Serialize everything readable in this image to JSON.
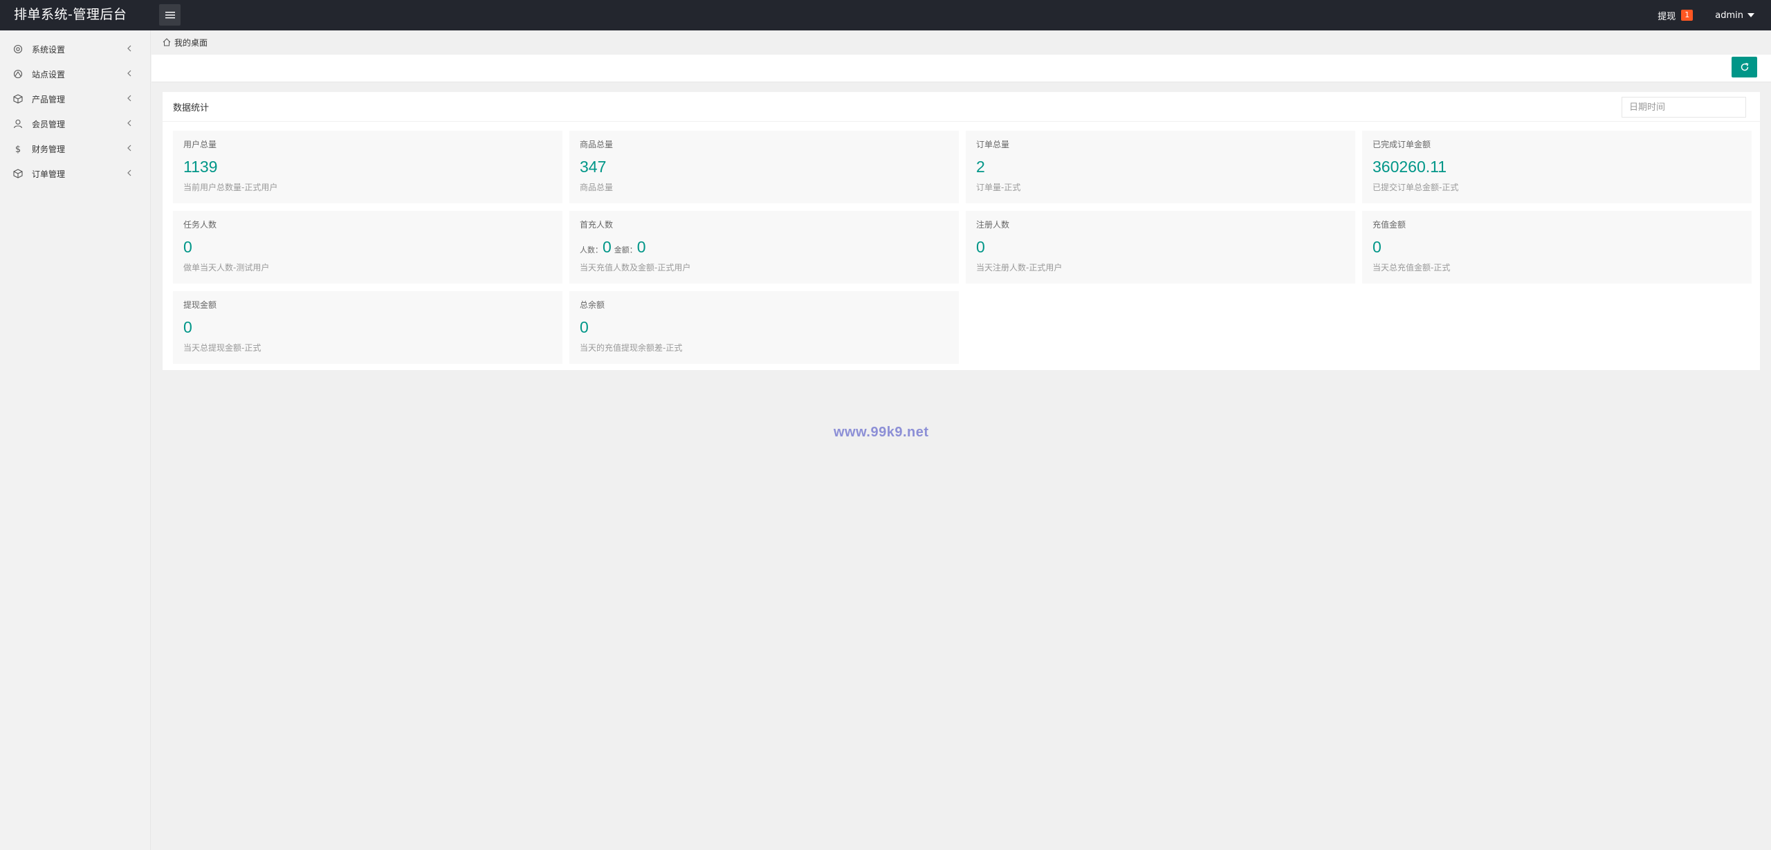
{
  "header": {
    "logo": "排单系统-管理后台",
    "withdraw_label": "提现",
    "withdraw_badge": "1",
    "user": "admin"
  },
  "sidebar": {
    "items": [
      {
        "label": "系统设置",
        "icon": "settings-icon"
      },
      {
        "label": "站点设置",
        "icon": "site-icon"
      },
      {
        "label": "产品管理",
        "icon": "product-icon"
      },
      {
        "label": "会员管理",
        "icon": "user-icon"
      },
      {
        "label": "财务管理",
        "icon": "dollar-icon"
      },
      {
        "label": "订单管理",
        "icon": "order-icon"
      }
    ]
  },
  "breadcrumb": {
    "home": "我的桌面"
  },
  "panel": {
    "title": "数据统计",
    "date_placeholder": "日期时间"
  },
  "cards": [
    {
      "title": "用户总量",
      "value": "1139",
      "desc": "当前用户总数量-正式用户"
    },
    {
      "title": "商品总量",
      "value": "347",
      "desc": "商品总量"
    },
    {
      "title": "订单总量",
      "value": "2",
      "desc": "订单量-正式"
    },
    {
      "title": "已完成订单金额",
      "value": "360260.11",
      "desc": "已提交订单总金额-正式"
    },
    {
      "title": "任务人数",
      "value": "0",
      "desc": "做单当天人数-测试用户"
    },
    {
      "title": "首充人数",
      "count_label": "人数：",
      "count": "0",
      "amount_label": "金额：",
      "amount": "0",
      "desc": "当天充值人数及金额-正式用户"
    },
    {
      "title": "注册人数",
      "value": "0",
      "desc": "当天注册人数-正式用户"
    },
    {
      "title": "充值金额",
      "value": "0",
      "desc": "当天总充值金额-正式"
    },
    {
      "title": "提现金额",
      "value": "0",
      "desc": "当天总提现金额-正式"
    },
    {
      "title": "总余额",
      "value": "0",
      "desc": "当天的充值提现余额差-正式"
    }
  ],
  "watermark": "www.99k9.net",
  "colors": {
    "accent": "#009688",
    "header_bg": "#23262e",
    "badge": "#ff5722"
  }
}
